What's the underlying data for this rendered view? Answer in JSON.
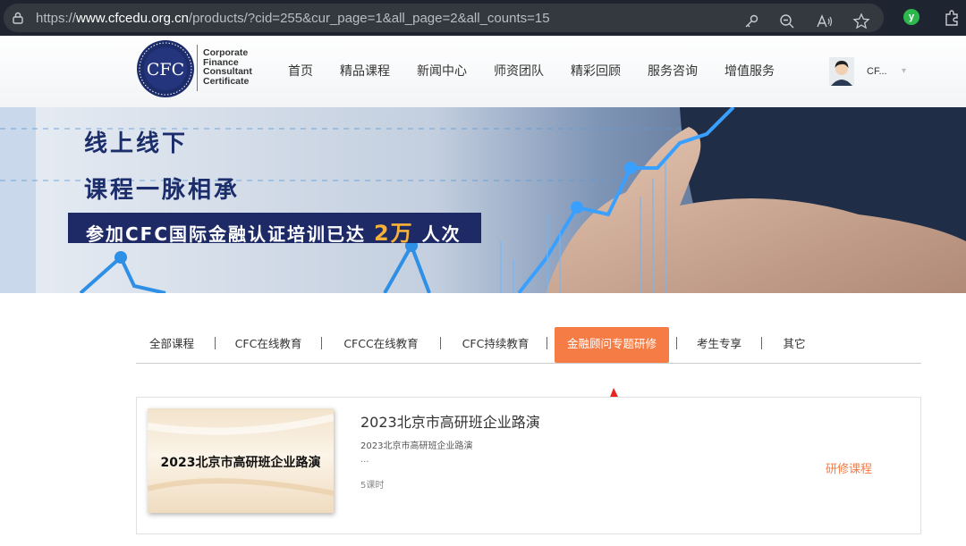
{
  "browser": {
    "url_prefix": "https://",
    "url_host": "www.cfcedu.org.cn",
    "url_path": "/products/?cid=255&cur_page=1&all_page=2&all_counts=15",
    "extension_badge": "y",
    "icons": [
      "lock-icon",
      "key-icon",
      "zoom-icon",
      "read-aloud-icon",
      "star-icon",
      "extensions-icon"
    ]
  },
  "header": {
    "logo_mark": "CFC",
    "logo_lines": [
      "Corporate",
      "Finance",
      "Consultant",
      "Certificate"
    ],
    "nav": [
      "首页",
      "精品课程",
      "新闻中心",
      "师资团队",
      "精彩回顾",
      "服务咨询",
      "增值服务"
    ],
    "user_name": "CF...",
    "user_caret": "▾"
  },
  "banner": {
    "line1": "线上线下",
    "line2": "课程一脉相承",
    "strip_before": "参加CFC国际金融认证培训已达 ",
    "strip_highlight": "2万",
    "strip_after": " 人次"
  },
  "tabs": [
    "全部课程",
    "CFC在线教育",
    "CFCC在线教育",
    "CFC持续教育",
    "金融顾问专题研修",
    "考生专享",
    "其它"
  ],
  "active_tab": "金融顾问专题研修",
  "course": {
    "thumb_text": "2023北京市高研班企业路演",
    "title": "2023北京市高研班企业路演",
    "subtitle": "2023北京市高研班企业路演",
    "ellipsis": "...",
    "hours": "5课时",
    "type": "研修课程"
  },
  "colors": {
    "accent": "#f57c45",
    "banner_navy": "#1e2a66",
    "banner_highlight": "#f7b13a",
    "annotation_arrow": "#e8251c"
  }
}
